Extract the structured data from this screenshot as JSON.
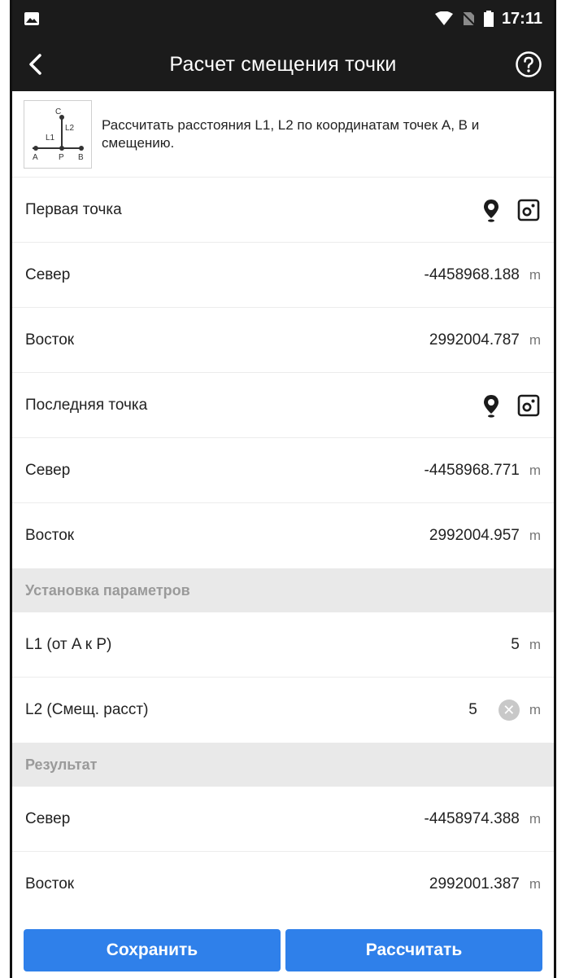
{
  "status_bar": {
    "time": "17:11"
  },
  "appbar": {
    "title": "Расчет смещения точки"
  },
  "description": {
    "text": "Рассчитать расстояния L1, L2 по координатам точек A, B и смещению.",
    "diagram_labels": {
      "c": "C",
      "l1": "L1",
      "l2": "L2",
      "a": "A",
      "p": "P",
      "b": "B"
    }
  },
  "first_point": {
    "title": "Первая точка",
    "north": {
      "label": "Север",
      "value": "-4458968.188",
      "unit": "m"
    },
    "east": {
      "label": "Восток",
      "value": "2992004.787",
      "unit": "m"
    }
  },
  "last_point": {
    "title": "Последняя точка",
    "north": {
      "label": "Север",
      "value": "-4458968.771",
      "unit": "m"
    },
    "east": {
      "label": "Восток",
      "value": "2992004.957",
      "unit": "m"
    }
  },
  "parameters": {
    "title": "Установка параметров",
    "l1": {
      "label": "L1 (от A к P)",
      "value": "5",
      "unit": "m"
    },
    "l2": {
      "label": "L2 (Смещ. расст)",
      "value": "5",
      "unit": "m"
    }
  },
  "result": {
    "title": "Результат",
    "north": {
      "label": "Север",
      "value": "-4458974.388",
      "unit": "m"
    },
    "east": {
      "label": "Восток",
      "value": "2992001.387",
      "unit": "m"
    }
  },
  "buttons": {
    "save": "Сохранить",
    "calculate": "Рассчитать"
  },
  "colors": {
    "appbar": "#1b1b1b",
    "accent": "#2f80ea",
    "group_header": "#e9e9e9"
  }
}
